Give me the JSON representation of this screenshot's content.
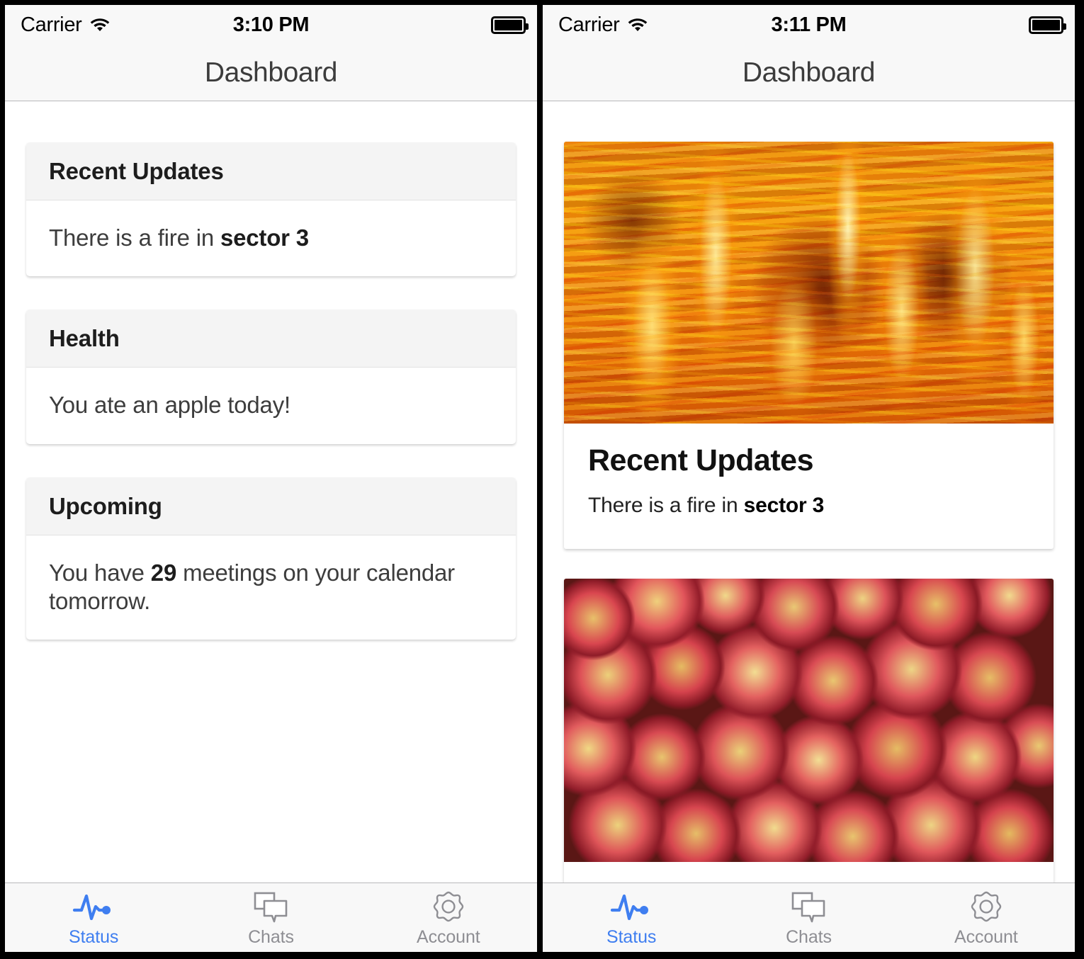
{
  "accent_color": "#3f7ef0",
  "inactive_color": "#8e8e93",
  "panels": [
    {
      "name": "list-view",
      "status_bar": {
        "carrier": "Carrier",
        "wifi_icon": "wifi-icon",
        "time": "3:10 PM",
        "battery_icon": "battery-full-icon"
      },
      "navbar": {
        "title": "Dashboard"
      },
      "cards": [
        {
          "header": "Recent Updates",
          "text_prefix": "There is a fire in ",
          "text_bold": "sector 3",
          "text_suffix": ""
        },
        {
          "header": "Health",
          "text_prefix": "You ate an apple today!",
          "text_bold": "",
          "text_suffix": ""
        },
        {
          "header": "Upcoming",
          "text_prefix": "You have ",
          "text_bold": "29",
          "text_suffix": " meetings on your calendar tomorrow."
        }
      ],
      "tabs": [
        {
          "label": "Status",
          "icon": "pulse-icon",
          "active": true
        },
        {
          "label": "Chats",
          "icon": "chats-icon",
          "active": false
        },
        {
          "label": "Account",
          "icon": "gear-icon",
          "active": false
        }
      ]
    },
    {
      "name": "feed-view",
      "status_bar": {
        "carrier": "Carrier",
        "wifi_icon": "wifi-icon",
        "time": "3:11 PM",
        "battery_icon": "battery-full-icon"
      },
      "navbar": {
        "title": "Dashboard"
      },
      "cards": [
        {
          "image": "fire-photo",
          "title": "Recent Updates",
          "text_prefix": "There is a fire in ",
          "text_bold": "sector 3",
          "text_suffix": ""
        },
        {
          "image": "apples-photo",
          "title": "",
          "text_prefix": "",
          "text_bold": "",
          "text_suffix": ""
        }
      ],
      "tabs": [
        {
          "label": "Status",
          "icon": "pulse-icon",
          "active": true
        },
        {
          "label": "Chats",
          "icon": "chats-icon",
          "active": false
        },
        {
          "label": "Account",
          "icon": "gear-icon",
          "active": false
        }
      ]
    }
  ]
}
